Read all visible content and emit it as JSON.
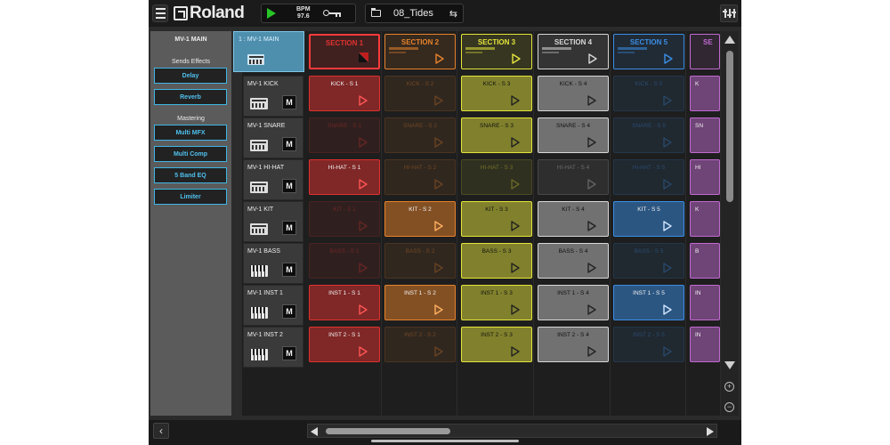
{
  "app": {
    "brand": "Roland",
    "bpm_label": "BPM",
    "bpm_value": "97.6",
    "project_name": "08_Tides"
  },
  "left_panel": {
    "title": "MV-1 MAIN",
    "sends_label": "Sends Effects",
    "sends": [
      "Delay",
      "Reverb"
    ],
    "mastering_label": "Mastering",
    "mastering": [
      "Multi MFX",
      "Multi Comp",
      "5 Band EQ",
      "Limiter"
    ]
  },
  "main_track": {
    "label": "1 : MV-1 MAIN"
  },
  "tracks": [
    {
      "name": "MV-1 KICK",
      "icon": "drum-machine-icon",
      "mute": "M"
    },
    {
      "name": "MV-1 SNARE",
      "icon": "drum-machine-icon",
      "mute": "M"
    },
    {
      "name": "MV-1 HI-HAT",
      "icon": "drum-machine-icon",
      "mute": "M"
    },
    {
      "name": "MV-1 KIT",
      "icon": "drum-machine-icon",
      "mute": "M"
    },
    {
      "name": "MV-1 BASS",
      "icon": "keyboard-icon",
      "mute": "M"
    },
    {
      "name": "MV-1 INST 1",
      "icon": "keyboard-icon",
      "mute": "M"
    },
    {
      "name": "MV-1 INST 2",
      "icon": "keyboard-icon",
      "mute": "M"
    }
  ],
  "sections": [
    {
      "label": "SECTION 1",
      "color": "#e0322f",
      "selected": true
    },
    {
      "label": "SECTION 2",
      "color": "#e8822a"
    },
    {
      "label": "SECTION 3",
      "color": "#e4e43c"
    },
    {
      "label": "SECTION 4",
      "color": "#d8d8d8"
    },
    {
      "label": "SECTION 5",
      "color": "#3a8ee6"
    },
    {
      "label": "SE",
      "color": "#c06ad0"
    }
  ],
  "clips": [
    [
      "KICK - S 1",
      "KICK - S 2",
      "KICK - S 3",
      "KICK - S 4",
      "KICK - S 5",
      "K"
    ],
    [
      "SNARE - S 1",
      "SNARE - S 2",
      "SNARE - S 3",
      "SNARE - S 4",
      "SNARE - S 5",
      "SN"
    ],
    [
      "HI-HAT - S 1",
      "HI-HAT - S 2",
      "HI-HAT - S 3",
      "HI-HAT - S 4",
      "HI-HAT - S 5",
      "HI"
    ],
    [
      "KIT - S 1",
      "KIT - S 2",
      "KIT - S 3",
      "KIT - S 4",
      "KIT - S 5",
      "K"
    ],
    [
      "BASS - S 1",
      "BASS - S 2",
      "BASS - S 3",
      "BASS - S 4",
      "BASS - S 5",
      "B"
    ],
    [
      "INST 1 - S 1",
      "INST 1 - S 2",
      "INST 1 - S 3",
      "INST 1 - S 4",
      "INST 1 - S 5",
      "IN"
    ],
    [
      "INST 2 - S 1",
      "INST 2 - S 2",
      "INST 2 - S 3",
      "INST 2 - S 4",
      "INST 2 - S 5",
      "IN"
    ]
  ],
  "clip_active": [
    [
      true,
      false,
      true,
      true,
      false,
      true
    ],
    [
      false,
      false,
      true,
      true,
      false,
      true
    ],
    [
      true,
      false,
      false,
      false,
      false,
      true
    ],
    [
      false,
      true,
      true,
      true,
      true,
      true
    ],
    [
      false,
      false,
      true,
      true,
      false,
      true
    ],
    [
      true,
      true,
      true,
      true,
      true,
      true
    ],
    [
      true,
      false,
      true,
      true,
      false,
      true
    ]
  ]
}
